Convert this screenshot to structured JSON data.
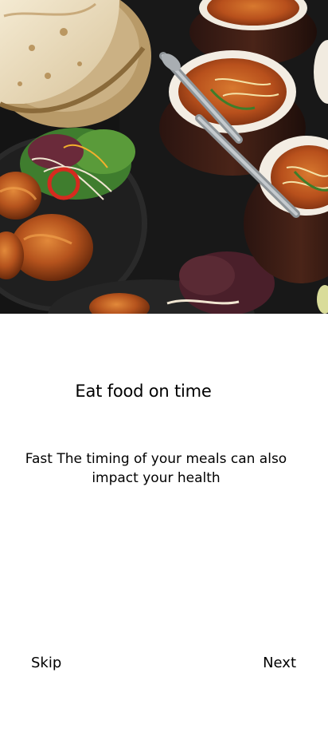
{
  "onboarding": {
    "image_description_icon": "food-photo",
    "title": "Eat food on time",
    "subtitle": "Fast The timing of your meals can also impact your health",
    "skip_label": "Skip",
    "next_label": "Next"
  }
}
